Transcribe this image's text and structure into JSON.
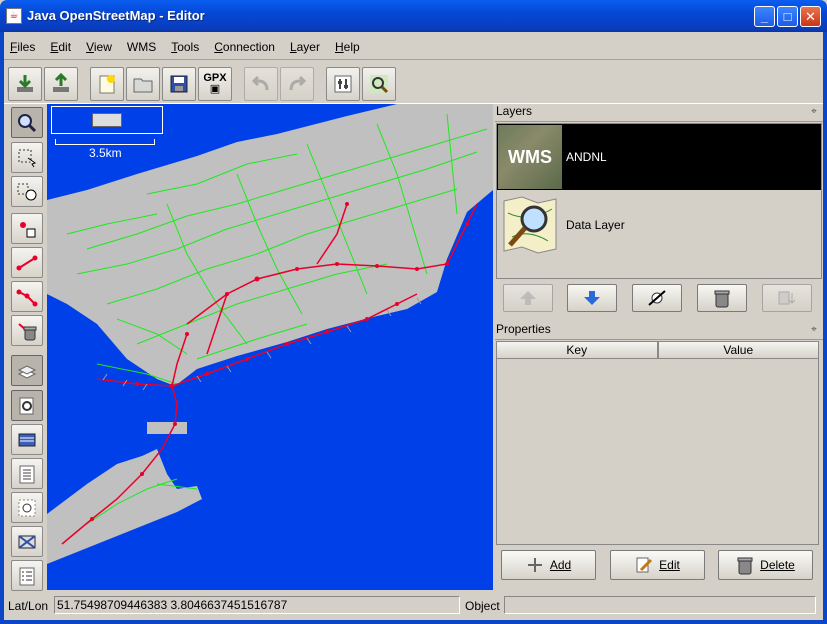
{
  "window": {
    "title": "Java OpenStreetMap - Editor",
    "minimize": "_",
    "maximize": "□",
    "close": "✕"
  },
  "menu": [
    {
      "label": "Files",
      "mnemonic": "F",
      "rest": "iles"
    },
    {
      "label": "Edit",
      "mnemonic": "E",
      "rest": "dit"
    },
    {
      "label": "View",
      "mnemonic": "V",
      "rest": "iew"
    },
    {
      "label": "WMS",
      "mnemonic": "",
      "rest": "WMS"
    },
    {
      "label": "Tools",
      "mnemonic": "T",
      "rest": "ools"
    },
    {
      "label": "Connection",
      "mnemonic": "C",
      "rest": "onnection"
    },
    {
      "label": "Layer",
      "mnemonic": "L",
      "rest": "ayer"
    },
    {
      "label": "Help",
      "mnemonic": "H",
      "rest": "elp"
    }
  ],
  "toolbar": {
    "gpx_label": "GPX",
    "buttons": [
      "download-icon",
      "upload-icon",
      "new-file-icon",
      "open-file-icon",
      "save-icon",
      "gpx-export-icon",
      "undo-icon",
      "redo-icon",
      "preferences-icon",
      "plugin-icon"
    ]
  },
  "left_tools": [
    "zoom-icon",
    "select-icon",
    "move-icon",
    "add-node-icon",
    "add-segment-icon",
    "add-way-icon",
    "delete-icon",
    "layer-toggle-icon",
    "properties-toggle-icon",
    "panel-3-icon",
    "panel-4-icon",
    "panel-5-icon",
    "panel-6-icon",
    "panel-7-icon"
  ],
  "map": {
    "scale_label": "3.5km",
    "water_color": "#0040e8",
    "land_color": "#c0c0c0",
    "road_color": "#1ee81e",
    "node_color": "#e8002a"
  },
  "layers": {
    "title": "Layers",
    "items": [
      {
        "name": "ANDNL",
        "icon_text": "WMS",
        "selected": true
      },
      {
        "name": "Data Layer",
        "icon_text": "",
        "selected": false
      }
    ],
    "buttons": [
      "move-up-icon",
      "move-down-icon",
      "toggle-visibility-icon",
      "delete-layer-icon",
      "merge-icon"
    ]
  },
  "properties": {
    "title": "Properties",
    "columns": [
      "Key",
      "Value"
    ],
    "add_label": "Add",
    "edit_label": "Edit",
    "delete_label": "Delete",
    "add_mnemonic": "A",
    "edit_mnemonic": "E",
    "delete_mnemonic": "D"
  },
  "status": {
    "latlon_label": "Lat/Lon",
    "latlon_value": "51.75498709446383 3.8046637451516787",
    "object_label": "Object",
    "object_value": ""
  }
}
